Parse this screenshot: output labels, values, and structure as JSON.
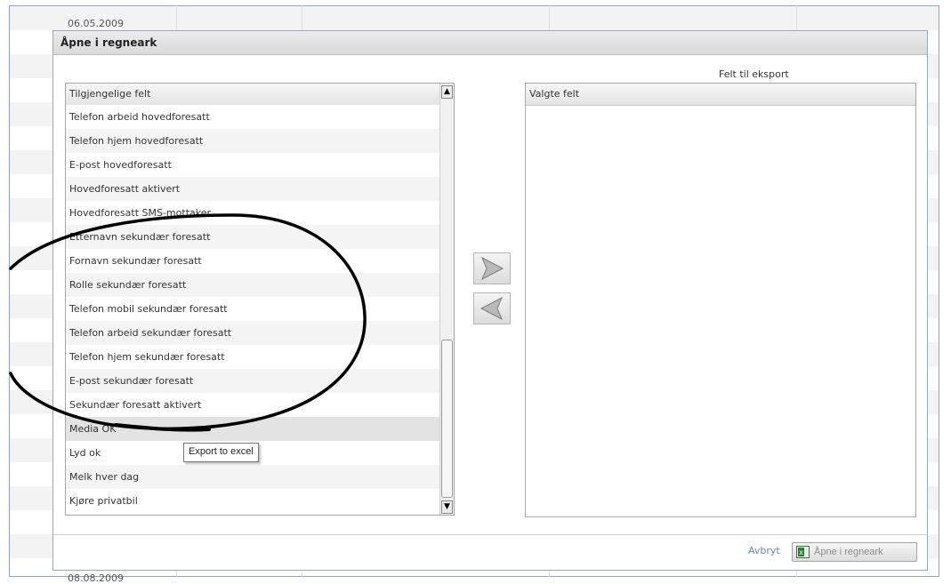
{
  "background": {
    "date_top": "06.05.2009",
    "date_bottom": "08.08.2009"
  },
  "dialog": {
    "title": "Åpne i regneark",
    "export_caption": "Felt til eksport"
  },
  "available": {
    "header": "Tilgjengelige felt",
    "items": [
      "Telefon arbeid hovedforesatt",
      "Telefon hjem hovedforesatt",
      "E-post hovedforesatt",
      "Hovedforesatt aktivert",
      "Hovedforesatt SMS-mottaker",
      "Etternavn sekundær foresatt",
      "Fornavn sekundær foresatt",
      "Rolle sekundær foresatt",
      "Telefon mobil sekundær foresatt",
      "Telefon arbeid sekundær foresatt",
      "Telefon hjem sekundær foresatt",
      "E-post sekundær foresatt",
      "Sekundær foresatt aktivert",
      "Media OK",
      "Lyd ok",
      "Melk hver dag",
      "Kjøre privatbil"
    ],
    "highlighted_item": "Media OK"
  },
  "selected": {
    "header": "Valgte felt",
    "items": []
  },
  "tooltip": "Export to excel",
  "footer": {
    "cancel_label": "Avbryt",
    "open_label": "Åpne i regneark"
  },
  "icons": {
    "move_right": "arrow-right-icon",
    "move_left": "arrow-left-icon",
    "excel": "excel-icon",
    "scroll_up": "scroll-up-icon",
    "scroll_down": "scroll-down-icon"
  },
  "colors": {
    "link": "#6b86a8",
    "annotation": "#000000",
    "title_bar": "#d9d9d9",
    "excel_green": "#2e7d32"
  }
}
